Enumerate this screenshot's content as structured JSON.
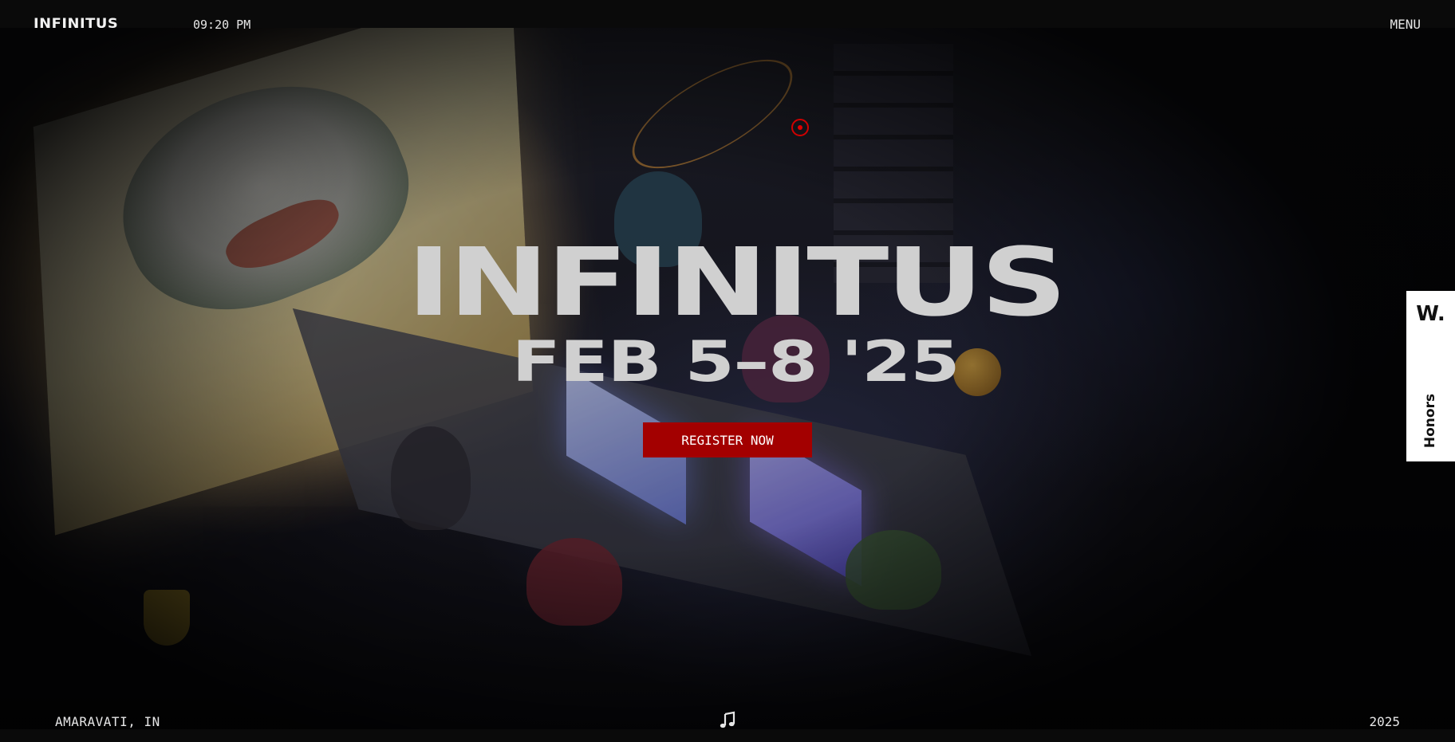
{
  "header": {
    "logo_text": "INFINITUS",
    "time": "09:20 PM",
    "menu_label": "MENU"
  },
  "hero": {
    "title": "INFINITUS",
    "dates": "FEB 5–8 '25",
    "cta_label": "REGISTER NOW"
  },
  "badge": {
    "mark": "W.",
    "label": "Honors"
  },
  "footer": {
    "location": "AMARAVATI, IN",
    "year": "2025",
    "music_icon": "music-note-icon"
  },
  "colors": {
    "accent": "#a30000",
    "target": "#d00000",
    "background": "#0a0a0a",
    "headline": "#d0d0d0"
  }
}
